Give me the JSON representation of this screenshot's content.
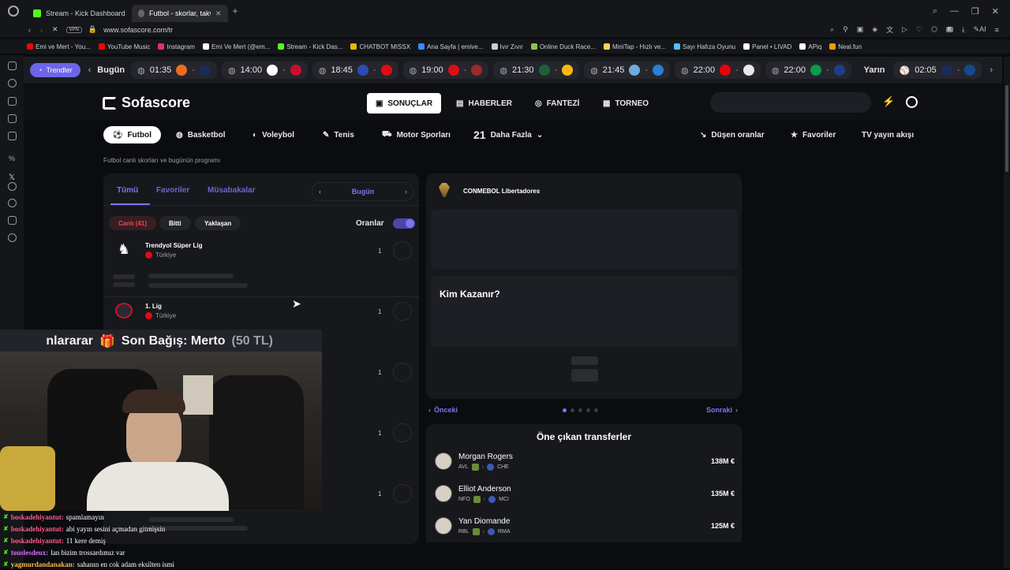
{
  "browser": {
    "tabs": [
      {
        "label": "Stream - Kick Dashboard",
        "color": "#53fc18"
      },
      {
        "label": "Futbol - skorlar, takvim & c",
        "color": "#8a8a8a"
      }
    ],
    "vpn_label": "VPN",
    "url": "www.sofascore.com/tr",
    "ai_label": "AI",
    "bookmarks": [
      {
        "label": "Emi ve Mert - You...",
        "color": "#ff0000"
      },
      {
        "label": "YouTube Music",
        "color": "#ff0000"
      },
      {
        "label": "Instagram",
        "color": "#e1306c"
      },
      {
        "label": "Emi Ve Mert (@em...",
        "color": "#ffffff"
      },
      {
        "label": "Stream - Kick Das...",
        "color": "#53fc18"
      },
      {
        "label": "CHATBOT MISSX",
        "color": "#f0b400"
      },
      {
        "label": "Ana Sayfa | emive...",
        "color": "#3a8bff"
      },
      {
        "label": "Ivır Zıvır",
        "color": "#cfcfcf"
      },
      {
        "label": "Online Duck Race...",
        "color": "#8bc34a"
      },
      {
        "label": "MiniTap - Hızlı ve...",
        "color": "#ffd54f"
      },
      {
        "label": "Sayı Hafıza Oyunu",
        "color": "#4fc3f7"
      },
      {
        "label": "Panel • LIVAD",
        "color": "#ffffff"
      },
      {
        "label": "APiq",
        "color": "#ffffff"
      },
      {
        "label": "Neal.fun",
        "color": "#ff9800"
      }
    ]
  },
  "strip": {
    "trend_label": "Trendler",
    "today_label": "Bugün",
    "tomorrow_label": "Yarın",
    "matches": [
      {
        "time": "01:35",
        "c1": "#f06b1f",
        "c2": "#1b2c5a"
      },
      {
        "time": "14:00",
        "c1": "#ffffff",
        "c2": "#c8102e"
      },
      {
        "time": "18:45",
        "c1": "#2b4cb5",
        "c2": "#e30a17"
      },
      {
        "time": "19:00",
        "c1": "#e30a17",
        "c2": "#9e2a2b"
      },
      {
        "time": "21:30",
        "c1": "#1e5f3a",
        "c2": "#fdb913"
      },
      {
        "time": "21:45",
        "c1": "#6cabdd",
        "c2": "#2a7fd4"
      },
      {
        "time": "22:00",
        "c1": "#ef0107",
        "c2": "#e8e8e8"
      },
      {
        "time": "22:00",
        "c1": "#0b9a4a",
        "c2": "#1c3f8c"
      }
    ],
    "tomorrow_match": {
      "time": "02:05",
      "c1": "#1b2c5a",
      "c2": "#134a8e"
    }
  },
  "header": {
    "logo": "Sofascore",
    "nav": [
      "SONUÇLAR",
      "HABERLER",
      "FANTEZİ",
      "TORNEO"
    ],
    "sports": [
      "Futbol",
      "Basketbol",
      "Voleybol",
      "Tenis",
      "Motor Sporları"
    ],
    "more_count": "21",
    "more_label": "Daha Fazla",
    "right": [
      "Düşen oranlar",
      "Favoriler",
      "TV yayın akışı"
    ]
  },
  "page": {
    "subtitle": "Futbol canlı skorları ve bugünün programı",
    "tabs": [
      "Tümü",
      "Favoriler",
      "Müsabakalar"
    ],
    "date_label": "Bugün",
    "filters": {
      "live": "Canlı (41)",
      "finished": "Bitti",
      "upcoming": "Yaklaşan"
    },
    "odds_label": "Oranlar",
    "leagues": [
      {
        "name": "Trendyol Süper Lig",
        "country": "Türkiye",
        "count": "1"
      },
      {
        "name": "1. Lig",
        "country": "Türkiye",
        "count": "1"
      }
    ],
    "row_counts": [
      "1",
      "1",
      "1"
    ]
  },
  "right_panel": {
    "competition": "CONMEBOL Libertadores",
    "question": "Kim Kazanır?",
    "prev": "Önceki",
    "next": "Sonraki",
    "transfers_title": "Öne çıkan transferler",
    "transfers": [
      {
        "name": "Morgan Rogers",
        "from": "AVL",
        "to": "CHE",
        "fee": "138M €"
      },
      {
        "name": "Elliot Anderson",
        "from": "NFO",
        "to": "MCI",
        "fee": "135M €"
      },
      {
        "name": "Yan Diomande",
        "from": "RBL",
        "to": "RMA",
        "fee": "125M €"
      }
    ]
  },
  "stream": {
    "ticker_left": "nlararar",
    "donation": "Son Bağış: Merto",
    "donation_amount": "(50 TL)",
    "chat": [
      {
        "user": "boskadehiyantut:",
        "msg": "spamlamayın"
      },
      {
        "user": "boskadehiyantut:",
        "msg": "abi yayın sesini açmadan gitmişsin"
      },
      {
        "user": "boskadehiyantut:",
        "msg": "11 kere demiş"
      },
      {
        "user": "touslesdeux:",
        "msg": "lan bizim trossardımız var"
      },
      {
        "user": "yagmurdandanakan:",
        "msg": "sahanın en cok adam eksilten ismi"
      }
    ]
  }
}
